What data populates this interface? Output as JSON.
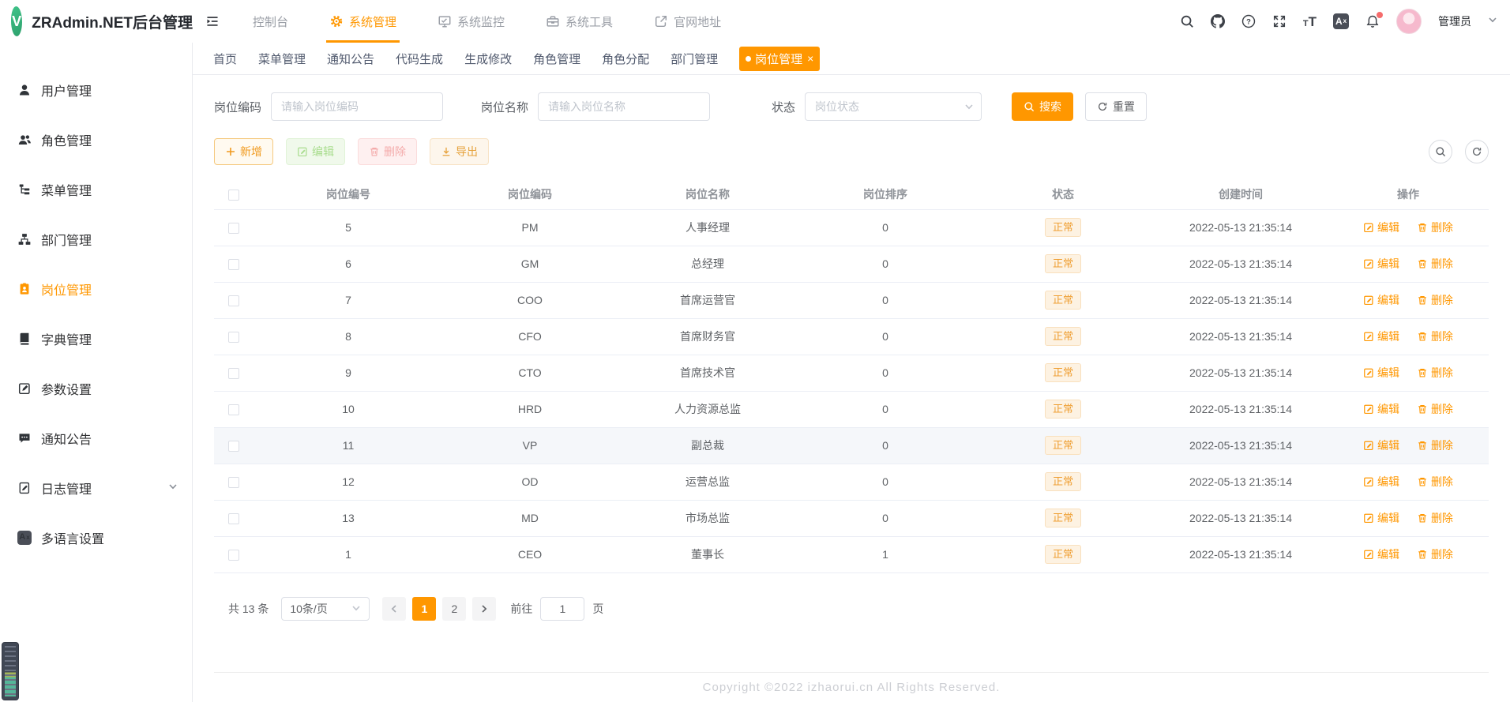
{
  "app": {
    "title": "ZRAdmin.NET后台管理",
    "logo_letter": "V"
  },
  "colors": {
    "accent": "#ff9700",
    "status_tag_text": "#ef9f33",
    "status_tag_bg": "#fdf2e2"
  },
  "header": {
    "fontsize_small": "T",
    "fontsize_big": "T",
    "lang_main": "A",
    "lang_sup": "x",
    "help_glyph": "?",
    "user_name": "管理员"
  },
  "topnav": {
    "items": [
      {
        "label": "控制台",
        "icon": "none"
      },
      {
        "label": "系统管理",
        "icon": "gear-icon",
        "active": true
      },
      {
        "label": "系统监控",
        "icon": "monitor-icon"
      },
      {
        "label": "系统工具",
        "icon": "toolbox-icon"
      },
      {
        "label": "官网地址",
        "icon": "external-link-icon"
      }
    ]
  },
  "tabs": {
    "items": [
      {
        "label": "首页"
      },
      {
        "label": "菜单管理"
      },
      {
        "label": "通知公告"
      },
      {
        "label": "代码生成"
      },
      {
        "label": "生成修改"
      },
      {
        "label": "角色管理"
      },
      {
        "label": "角色分配"
      },
      {
        "label": "部门管理"
      },
      {
        "label": "岗位管理",
        "active": true
      }
    ],
    "close_label": "×"
  },
  "sidebar": {
    "items": [
      {
        "label": "用户管理",
        "icon": "user-icon"
      },
      {
        "label": "角色管理",
        "icon": "roles-icon"
      },
      {
        "label": "菜单管理",
        "icon": "menu-tree-icon"
      },
      {
        "label": "部门管理",
        "icon": "department-icon"
      },
      {
        "label": "岗位管理",
        "icon": "post-badge-icon",
        "active": true
      },
      {
        "label": "字典管理",
        "icon": "dictionary-icon"
      },
      {
        "label": "参数设置",
        "icon": "settings-edit-icon"
      },
      {
        "label": "通知公告",
        "icon": "notice-icon"
      },
      {
        "label": "日志管理",
        "icon": "log-icon",
        "expandable": true
      },
      {
        "label": "多语言设置",
        "icon": "i18n-icon"
      }
    ]
  },
  "filters": {
    "code_label": "岗位编码",
    "code_placeholder": "请输入岗位编码",
    "name_label": "岗位名称",
    "name_placeholder": "请输入岗位名称",
    "status_label": "状态",
    "status_placeholder": "岗位状态",
    "search_label": "搜索",
    "reset_label": "重置"
  },
  "toolbar": {
    "add_label": "新增",
    "edit_label": "编辑",
    "delete_label": "删除",
    "export_label": "导出"
  },
  "table": {
    "columns": [
      "岗位编号",
      "岗位编码",
      "岗位名称",
      "岗位排序",
      "状态",
      "创建时间",
      "操作"
    ],
    "edit_label": "编辑",
    "delete_label": "删除",
    "rows": [
      {
        "id": "5",
        "code": "PM",
        "name": "人事经理",
        "sort": "0",
        "status": "正常",
        "created": "2022-05-13 21:35:14"
      },
      {
        "id": "6",
        "code": "GM",
        "name": "总经理",
        "sort": "0",
        "status": "正常",
        "created": "2022-05-13 21:35:14"
      },
      {
        "id": "7",
        "code": "COO",
        "name": "首席运营官",
        "sort": "0",
        "status": "正常",
        "created": "2022-05-13 21:35:14"
      },
      {
        "id": "8",
        "code": "CFO",
        "name": "首席财务官",
        "sort": "0",
        "status": "正常",
        "created": "2022-05-13 21:35:14"
      },
      {
        "id": "9",
        "code": "CTO",
        "name": "首席技术官",
        "sort": "0",
        "status": "正常",
        "created": "2022-05-13 21:35:14"
      },
      {
        "id": "10",
        "code": "HRD",
        "name": "人力资源总监",
        "sort": "0",
        "status": "正常",
        "created": "2022-05-13 21:35:14"
      },
      {
        "id": "11",
        "code": "VP",
        "name": "副总裁",
        "sort": "0",
        "status": "正常",
        "created": "2022-05-13 21:35:14"
      },
      {
        "id": "12",
        "code": "OD",
        "name": "运营总监",
        "sort": "0",
        "status": "正常",
        "created": "2022-05-13 21:35:14"
      },
      {
        "id": "13",
        "code": "MD",
        "name": "市场总监",
        "sort": "0",
        "status": "正常",
        "created": "2022-05-13 21:35:14"
      },
      {
        "id": "1",
        "code": "CEO",
        "name": "董事长",
        "sort": "1",
        "status": "正常",
        "created": "2022-05-13 21:35:14"
      }
    ]
  },
  "pagination": {
    "total_label": "共 13 条",
    "page_size": "10条/页",
    "pages": [
      "1",
      "2"
    ],
    "goto_label": "前往",
    "goto_value": "1",
    "page_unit": "页"
  },
  "footer": {
    "copyright": "Copyright ©2022 izhaorui.cn All Rights Reserved."
  }
}
